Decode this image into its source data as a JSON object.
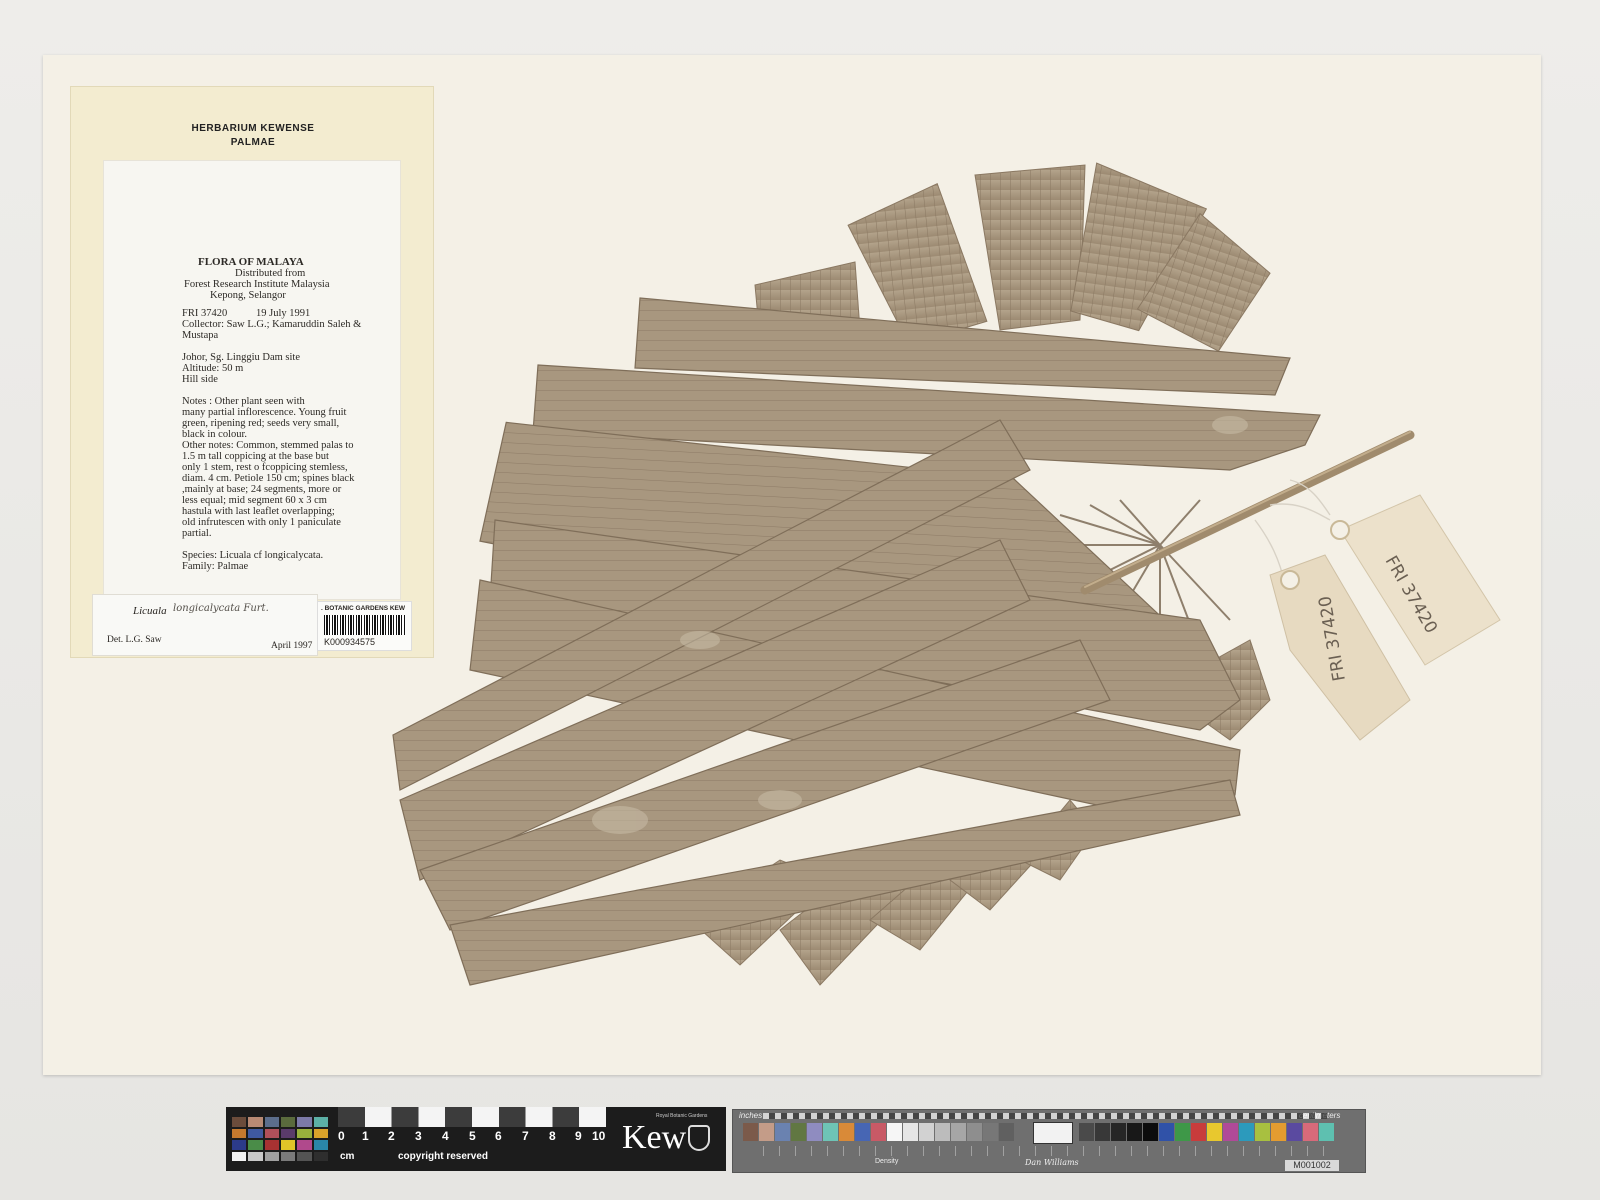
{
  "herbarium": {
    "line1": "HERBARIUM KEWENSE",
    "line2": "PALMAE"
  },
  "label": {
    "flora": "FLORA OF MALAYA",
    "distributed": "Distributed from",
    "institute": "Forest Research Institute Malaysia",
    "location": "Kepong, Selangor",
    "fri_number": "FRI 37420",
    "date": "19 July 1991",
    "collector_1": "Collector: Saw L.G.; Kamaruddin Saleh &",
    "collector_2": "Mustapa",
    "site": "Johor, Sg. Linggiu Dam site",
    "altitude": "Altitude:  50 m",
    "habitat": "Hill side",
    "notes_lines": [
      "Notes :    Other plant seen with",
      "many partial inflorescence. Young fruit",
      "green, ripening red; seeds very small,",
      "black in colour.",
      "Other notes: Common, stemmed palas to",
      "1.5 m tall coppicing at the base but",
      "only 1 stem, rest o fcoppicing stemless,",
      "diam. 4 cm. Petiole 150 cm; spines black",
      ",mainly at base; 24 segments, more or",
      "less equal; mid segment 60 x 3 cm",
      "hastula with last leaflet overlapping;",
      "old infrutescen with only 1 paniculate",
      "partial."
    ],
    "species": "Species: Licuala cf longicalycata.",
    "family": "Family:  Palmae"
  },
  "determination": {
    "genus": "Licuala",
    "epithet": "longicalycata Furt.",
    "det": "Det.  L.G. Saw",
    "date": "April 1997"
  },
  "barcode": {
    "institution": ". BOTANIC GARDENS KEW",
    "number": "K000934575"
  },
  "tags": {
    "tag1": "FRI 37420",
    "tag2": "FRI 37420"
  },
  "scale_bar": {
    "numbers": [
      "0",
      "1",
      "2",
      "3",
      "4",
      "5",
      "6",
      "7",
      "8",
      "9",
      "10"
    ],
    "unit": "cm",
    "copyright": "copyright reserved",
    "logo": "Kew",
    "logo_small": "Royal Botanic Gardens"
  },
  "color_target": {
    "inches": "inches",
    "centimeters": "centimeters",
    "density": "Density",
    "maker": "Dan Williams",
    "code": "M001002"
  },
  "colors": {
    "sheet": "#f4f0e6",
    "label_paper": "#f3ecd0",
    "leaf": "#a89780",
    "leaf_dark": "#8d7c66",
    "tag_paper": "#e9dcc4"
  }
}
